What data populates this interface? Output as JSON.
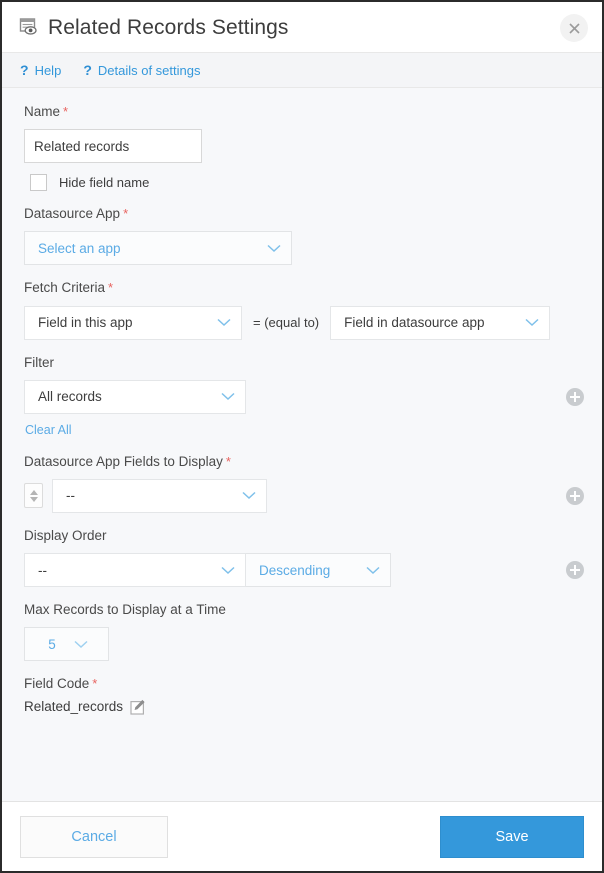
{
  "window": {
    "title": "Related Records Settings",
    "title_icon": "related-records-icon",
    "close_label": "×"
  },
  "helpbar": {
    "links": [
      {
        "icon": "question-mark-icon",
        "label": "Help"
      },
      {
        "icon": "question-mark-icon",
        "label": "Details of settings"
      }
    ]
  },
  "form": {
    "name": {
      "label": "Name",
      "required": "*",
      "value": "Related records",
      "placeholder": "Related records"
    },
    "hide_field_name": {
      "label": "Hide field name",
      "checked": false
    },
    "datasource_app": {
      "label": "Datasource App",
      "required": "*",
      "value": "Select an app"
    },
    "fetch_criteria": {
      "label": "Fetch Criteria",
      "required": "*",
      "left_value": "Field in this app",
      "operator": "= (equal to)",
      "right_value": "Field in datasource app"
    },
    "filter": {
      "label": "Filter",
      "value": "All records",
      "clear_all": "Clear All",
      "add_label": "+"
    },
    "fields_to_display": {
      "label": "Datasource App Fields to Display",
      "required": "*",
      "value": "--",
      "add_label": "+"
    },
    "display_order": {
      "label": "Display Order",
      "value": "--",
      "direction": "Descending",
      "add_label": "+"
    },
    "max_records": {
      "label": "Max Records to Display at a Time",
      "value": "5"
    },
    "field_code": {
      "label": "Field Code",
      "required": "*",
      "value": "Related_records",
      "edit_icon": "edit-pencil-icon"
    }
  },
  "footer": {
    "cancel_label": "Cancel",
    "save_label": "Save"
  },
  "colors": {
    "accent_blue": "#3498db",
    "link_blue": "#5babe5",
    "required_red": "#e8635f",
    "page_bg": "#f7f8fa"
  }
}
